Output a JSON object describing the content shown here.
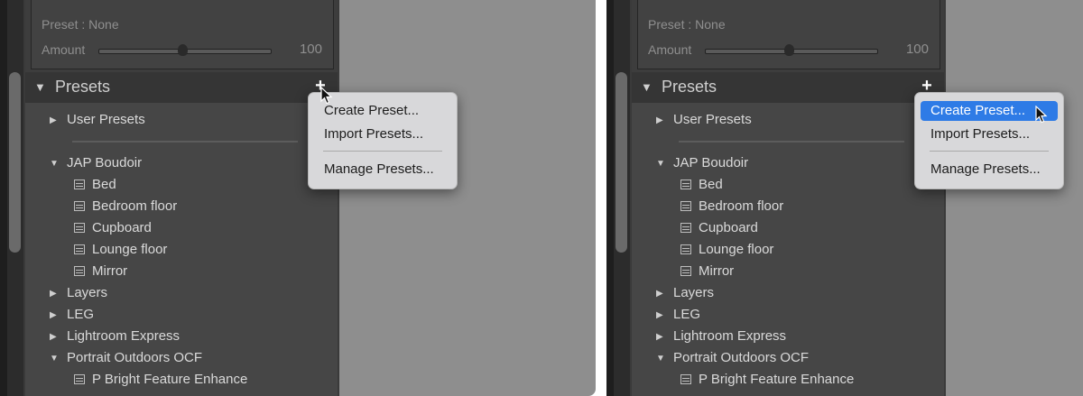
{
  "panels": [
    {
      "preset_label": "Preset : None",
      "amount_label": "Amount",
      "amount_value": "100",
      "amount_slider_fraction": 0.5,
      "section_title": "Presets",
      "add_button": "+",
      "groups": {
        "user_presets": "User Presets",
        "jap_boudoir": "JAP Boudoir",
        "jap_items": [
          "Bed",
          "Bedroom floor",
          "Cupboard",
          "Lounge floor",
          "Mirror"
        ],
        "layers": "Layers",
        "leg": "LEG",
        "lightroom_express": "Lightroom Express",
        "portrait": "Portrait Outdoors OCF",
        "portrait_item": "P Bright Feature Enhance"
      },
      "menu": {
        "create": "Create Preset...",
        "import": "Import Presets...",
        "manage": "Manage Presets...",
        "highlighted": "none"
      }
    },
    {
      "preset_label": "Preset : None",
      "amount_label": "Amount",
      "amount_value": "100",
      "amount_slider_fraction": 0.5,
      "section_title": "Presets",
      "add_button": "+",
      "groups": {
        "user_presets": "User Presets",
        "jap_boudoir": "JAP Boudoir",
        "jap_items": [
          "Bed",
          "Bedroom floor",
          "Cupboard",
          "Lounge floor",
          "Mirror"
        ],
        "layers": "Layers",
        "leg": "LEG",
        "lightroom_express": "Lightroom Express",
        "portrait": "Portrait Outdoors OCF",
        "portrait_item": "P Bright Feature Enhance"
      },
      "menu": {
        "create": "Create Preset...",
        "import": "Import Presets...",
        "manage": "Manage Presets...",
        "highlighted": "create"
      }
    }
  ],
  "colors": {
    "menu_highlight": "#2e7be6",
    "panel_bg": "#464646",
    "header_bg": "#353535"
  },
  "icons": {
    "expanded": "triangle-down-icon",
    "collapsed": "triangle-right-icon",
    "preset_item": "preset-list-icon",
    "cursor": "arrow-cursor-icon"
  }
}
